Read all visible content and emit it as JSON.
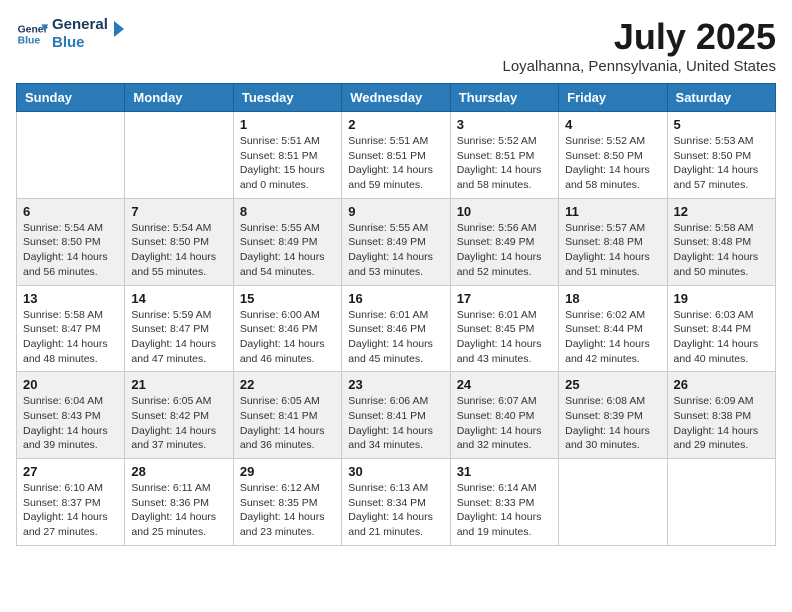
{
  "logo": {
    "line1": "General",
    "line2": "Blue"
  },
  "title": "July 2025",
  "location": "Loyalhanna, Pennsylvania, United States",
  "weekdays": [
    "Sunday",
    "Monday",
    "Tuesday",
    "Wednesday",
    "Thursday",
    "Friday",
    "Saturday"
  ],
  "weeks": [
    [
      null,
      null,
      {
        "day": "1",
        "sunrise": "5:51 AM",
        "sunset": "8:51 PM",
        "daylight": "15 hours and 0 minutes."
      },
      {
        "day": "2",
        "sunrise": "5:51 AM",
        "sunset": "8:51 PM",
        "daylight": "14 hours and 59 minutes."
      },
      {
        "day": "3",
        "sunrise": "5:52 AM",
        "sunset": "8:51 PM",
        "daylight": "14 hours and 58 minutes."
      },
      {
        "day": "4",
        "sunrise": "5:52 AM",
        "sunset": "8:50 PM",
        "daylight": "14 hours and 58 minutes."
      },
      {
        "day": "5",
        "sunrise": "5:53 AM",
        "sunset": "8:50 PM",
        "daylight": "14 hours and 57 minutes."
      }
    ],
    [
      {
        "day": "6",
        "sunrise": "5:54 AM",
        "sunset": "8:50 PM",
        "daylight": "14 hours and 56 minutes."
      },
      {
        "day": "7",
        "sunrise": "5:54 AM",
        "sunset": "8:50 PM",
        "daylight": "14 hours and 55 minutes."
      },
      {
        "day": "8",
        "sunrise": "5:55 AM",
        "sunset": "8:49 PM",
        "daylight": "14 hours and 54 minutes."
      },
      {
        "day": "9",
        "sunrise": "5:55 AM",
        "sunset": "8:49 PM",
        "daylight": "14 hours and 53 minutes."
      },
      {
        "day": "10",
        "sunrise": "5:56 AM",
        "sunset": "8:49 PM",
        "daylight": "14 hours and 52 minutes."
      },
      {
        "day": "11",
        "sunrise": "5:57 AM",
        "sunset": "8:48 PM",
        "daylight": "14 hours and 51 minutes."
      },
      {
        "day": "12",
        "sunrise": "5:58 AM",
        "sunset": "8:48 PM",
        "daylight": "14 hours and 50 minutes."
      }
    ],
    [
      {
        "day": "13",
        "sunrise": "5:58 AM",
        "sunset": "8:47 PM",
        "daylight": "14 hours and 48 minutes."
      },
      {
        "day": "14",
        "sunrise": "5:59 AM",
        "sunset": "8:47 PM",
        "daylight": "14 hours and 47 minutes."
      },
      {
        "day": "15",
        "sunrise": "6:00 AM",
        "sunset": "8:46 PM",
        "daylight": "14 hours and 46 minutes."
      },
      {
        "day": "16",
        "sunrise": "6:01 AM",
        "sunset": "8:46 PM",
        "daylight": "14 hours and 45 minutes."
      },
      {
        "day": "17",
        "sunrise": "6:01 AM",
        "sunset": "8:45 PM",
        "daylight": "14 hours and 43 minutes."
      },
      {
        "day": "18",
        "sunrise": "6:02 AM",
        "sunset": "8:44 PM",
        "daylight": "14 hours and 42 minutes."
      },
      {
        "day": "19",
        "sunrise": "6:03 AM",
        "sunset": "8:44 PM",
        "daylight": "14 hours and 40 minutes."
      }
    ],
    [
      {
        "day": "20",
        "sunrise": "6:04 AM",
        "sunset": "8:43 PM",
        "daylight": "14 hours and 39 minutes."
      },
      {
        "day": "21",
        "sunrise": "6:05 AM",
        "sunset": "8:42 PM",
        "daylight": "14 hours and 37 minutes."
      },
      {
        "day": "22",
        "sunrise": "6:05 AM",
        "sunset": "8:41 PM",
        "daylight": "14 hours and 36 minutes."
      },
      {
        "day": "23",
        "sunrise": "6:06 AM",
        "sunset": "8:41 PM",
        "daylight": "14 hours and 34 minutes."
      },
      {
        "day": "24",
        "sunrise": "6:07 AM",
        "sunset": "8:40 PM",
        "daylight": "14 hours and 32 minutes."
      },
      {
        "day": "25",
        "sunrise": "6:08 AM",
        "sunset": "8:39 PM",
        "daylight": "14 hours and 30 minutes."
      },
      {
        "day": "26",
        "sunrise": "6:09 AM",
        "sunset": "8:38 PM",
        "daylight": "14 hours and 29 minutes."
      }
    ],
    [
      {
        "day": "27",
        "sunrise": "6:10 AM",
        "sunset": "8:37 PM",
        "daylight": "14 hours and 27 minutes."
      },
      {
        "day": "28",
        "sunrise": "6:11 AM",
        "sunset": "8:36 PM",
        "daylight": "14 hours and 25 minutes."
      },
      {
        "day": "29",
        "sunrise": "6:12 AM",
        "sunset": "8:35 PM",
        "daylight": "14 hours and 23 minutes."
      },
      {
        "day": "30",
        "sunrise": "6:13 AM",
        "sunset": "8:34 PM",
        "daylight": "14 hours and 21 minutes."
      },
      {
        "day": "31",
        "sunrise": "6:14 AM",
        "sunset": "8:33 PM",
        "daylight": "14 hours and 19 minutes."
      },
      null,
      null
    ]
  ]
}
